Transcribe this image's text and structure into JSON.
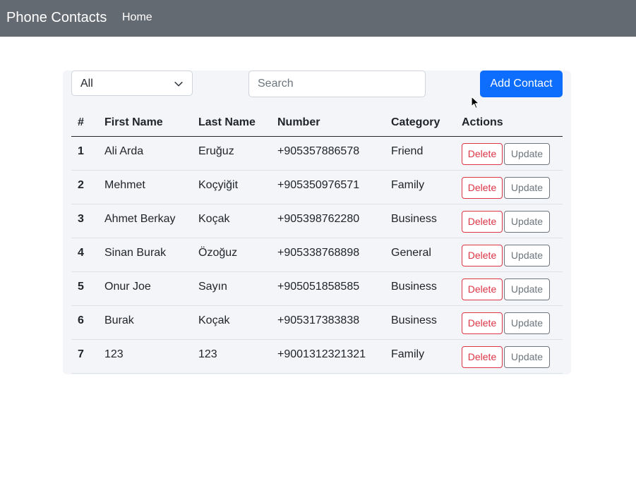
{
  "navbar": {
    "brand": "Phone Contacts",
    "home_link": "Home",
    "background": "#646a72"
  },
  "toolbar": {
    "category_select": {
      "selected": "All"
    },
    "search": {
      "value": "",
      "placeholder": "Search"
    },
    "add_button_label": "Add Contact",
    "accent": "#0d6efd"
  },
  "table": {
    "headers": {
      "index": "#",
      "first_name": "First Name",
      "last_name": "Last Name",
      "number": "Number",
      "category": "Category",
      "actions": "Actions"
    },
    "delete_label": "Delete",
    "update_label": "Update",
    "rows": [
      {
        "index": "1",
        "first_name": "Ali Arda",
        "last_name": "Eruğuz",
        "number": "+905357886578",
        "category": "Friend"
      },
      {
        "index": "2",
        "first_name": "Mehmet",
        "last_name": "Koçyiğit",
        "number": "+905350976571",
        "category": "Family"
      },
      {
        "index": "3",
        "first_name": "Ahmet Berkay",
        "last_name": "Koçak",
        "number": "+905398762280",
        "category": "Business"
      },
      {
        "index": "4",
        "first_name": "Sinan Burak",
        "last_name": "Özoğuz",
        "number": "+905338768898",
        "category": "General"
      },
      {
        "index": "5",
        "first_name": "Onur Joe",
        "last_name": "Sayın",
        "number": "+905051858585",
        "category": "Business"
      },
      {
        "index": "6",
        "first_name": "Burak",
        "last_name": "Koçak",
        "number": "+905317383838",
        "category": "Business"
      },
      {
        "index": "7",
        "first_name": "123",
        "last_name": "123",
        "number": "+9001312321321",
        "category": "Family"
      }
    ]
  },
  "icons": {
    "select_chevron": "chevron-down-icon",
    "cursor": "mouse-pointer-icon"
  }
}
